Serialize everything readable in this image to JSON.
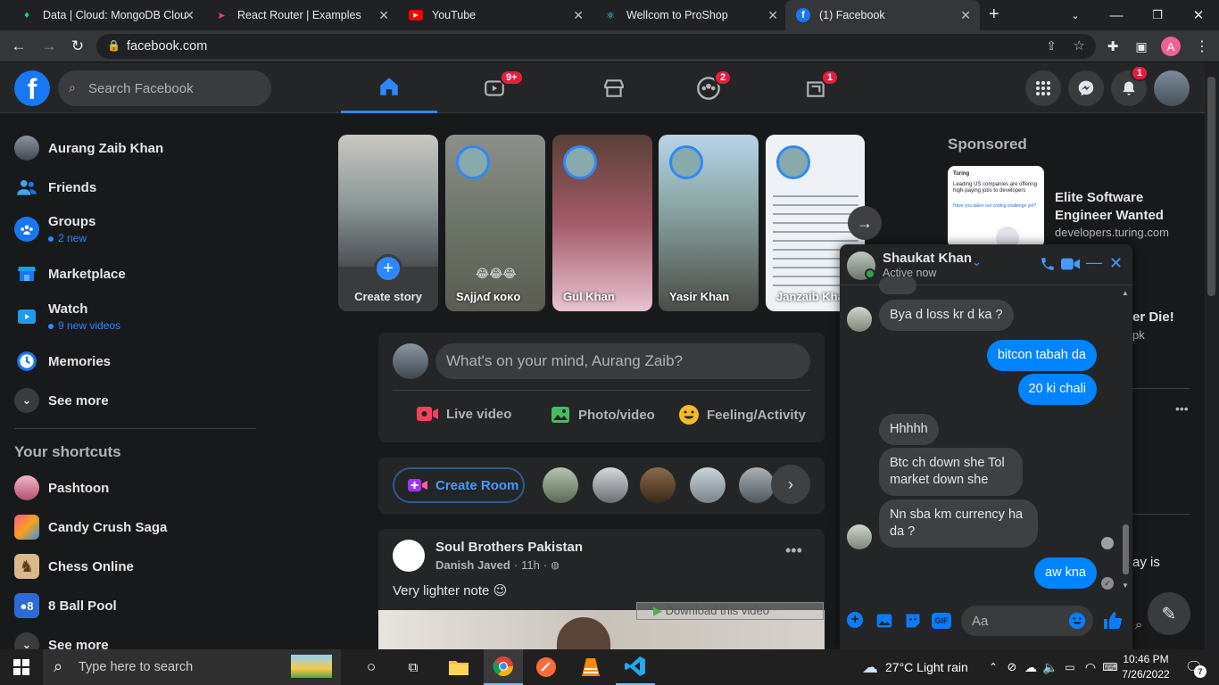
{
  "browser": {
    "tabs": [
      {
        "title": "Data | Cloud: MongoDB Clou",
        "icon": "mongodb-leaf-icon",
        "color": "#00ed64"
      },
      {
        "title": "React Router | Examples",
        "icon": "react-router-icon",
        "color": "#f44250"
      },
      {
        "title": "YouTube",
        "icon": "youtube-icon",
        "color": "#ff0000"
      },
      {
        "title": "Wellcom to ProShop",
        "icon": "react-icon",
        "color": "#61dafb"
      },
      {
        "title": "(1) Facebook",
        "icon": "facebook-icon",
        "color": "#1877f2"
      }
    ],
    "new_tab": "+",
    "url": "facebook.com",
    "profile_initial": "A"
  },
  "fb": {
    "logo": "f",
    "search_placeholder": "Search Facebook",
    "badges": {
      "watch": "9+",
      "groups": "2",
      "gaming": "1",
      "notifications": "1"
    },
    "sidebar": {
      "items": [
        {
          "label": "Aurang Zaib Khan",
          "icon": "profile-avatar"
        },
        {
          "label": "Friends",
          "icon": "friends-icon"
        },
        {
          "label": "Groups",
          "sub": "2 new",
          "icon": "groups-icon"
        },
        {
          "label": "Marketplace",
          "icon": "marketplace-icon"
        },
        {
          "label": "Watch",
          "sub": "9 new videos",
          "icon": "watch-icon"
        },
        {
          "label": "Memories",
          "icon": "memories-icon"
        },
        {
          "label": "See more",
          "icon": "chevron-down-icon"
        }
      ],
      "shortcuts_title": "Your shortcuts",
      "shortcuts": [
        {
          "label": "Pashtoon"
        },
        {
          "label": "Candy Crush Saga"
        },
        {
          "label": "Chess Online"
        },
        {
          "label": "8 Ball Pool"
        },
        {
          "label": "See more"
        }
      ]
    },
    "stories": [
      {
        "label": "Create story"
      },
      {
        "label": "Sʌjjʌɗ κoκo",
        "emoji": "😂😂😂"
      },
      {
        "label": "Gul Khan"
      },
      {
        "label": "Yasir Khan"
      },
      {
        "label": "Janzaib Khan"
      }
    ],
    "composer": {
      "placeholder": "What's on your mind, Aurang Zaib?",
      "live": "Live video",
      "photo": "Photo/video",
      "feeling": "Feeling/Activity"
    },
    "room": {
      "label": "Create Room"
    },
    "post": {
      "page": "Soul Brothers Pakistan",
      "author": "Danish Javed",
      "time": "11h",
      "text": "Very lighter note 😉",
      "download": "Download this video"
    },
    "sponsored": {
      "title": "Sponsored",
      "ad1_title": "Elite Software Engineer Wanted",
      "ad1_domain": "developers.turing.com",
      "ad1_img_text": "Leading US companies are offering high-paying jobs to developers",
      "ad1_img_link": "Have you taken our coding challenge yet?",
      "ad1_brand": "Turing",
      "ad2_title_partial": "er Die!",
      "ad2_domain_partial": "pk",
      "partial_text": "ay is"
    },
    "chat": {
      "name": "Shaukat Khan",
      "status": "Active now",
      "messages": [
        {
          "dir": "in",
          "text": "Bya d loss kr d ka ?"
        },
        {
          "dir": "out",
          "text": "bitcon tabah da"
        },
        {
          "dir": "out",
          "text": "20 ki chali"
        },
        {
          "dir": "in",
          "text": "Hhhhh"
        },
        {
          "dir": "in",
          "text": "Btc ch down she Tol market down she"
        },
        {
          "dir": "in",
          "text": "Nn sba km currency ha da ?"
        },
        {
          "dir": "out",
          "text": "aw kna"
        }
      ],
      "input_placeholder": "Aa"
    }
  },
  "taskbar": {
    "search_placeholder": "Type here to search",
    "weather": "27°C  Light rain",
    "time": "10:46 PM",
    "date": "7/26/2022",
    "notif_count": "7"
  }
}
